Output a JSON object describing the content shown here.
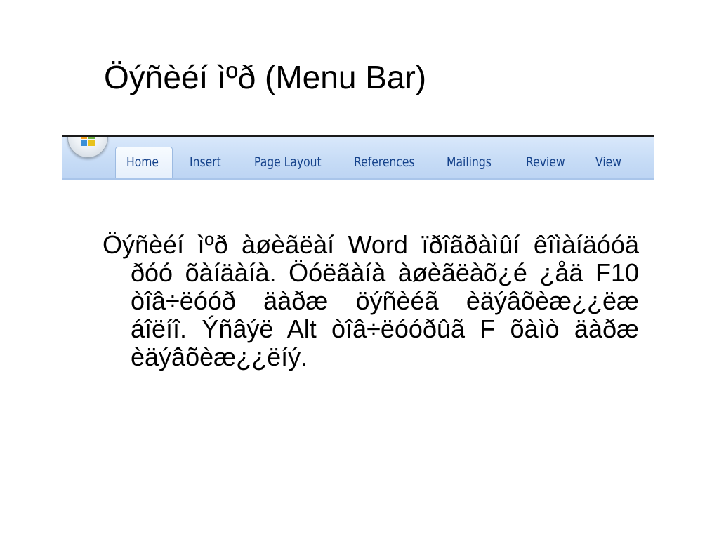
{
  "slide": {
    "title": "Öýñèéí ìºð (Menu Bar)",
    "body": "Öýñèéí ìºð àøèãëàí Word ïðîãðàìûí êîìàíäóóä ðóó õàíäàíà. Öóëãàíà àøèãëàõ¿é ¿åä F10 òîâ÷ëóóð äàðæ öýñèéã èäýâõèæ¿¿ëæ áîëíî. Ýñâýë Alt òîâ÷ëóóðûã F õàìò äàðæ èäýâõèæ¿¿ëíý."
  },
  "ribbon": {
    "office_button_icon": "office-logo-icon",
    "active_tab": "Home",
    "tabs": [
      "Home",
      "Insert",
      "Page Layout",
      "References",
      "Mailings",
      "Review",
      "View"
    ],
    "colors": {
      "tab_text": "#15428b",
      "ribbon_bg": "#c7dcf6",
      "active_tab_bg": "#eef4fc",
      "top_border": "#1a1a1a"
    }
  }
}
